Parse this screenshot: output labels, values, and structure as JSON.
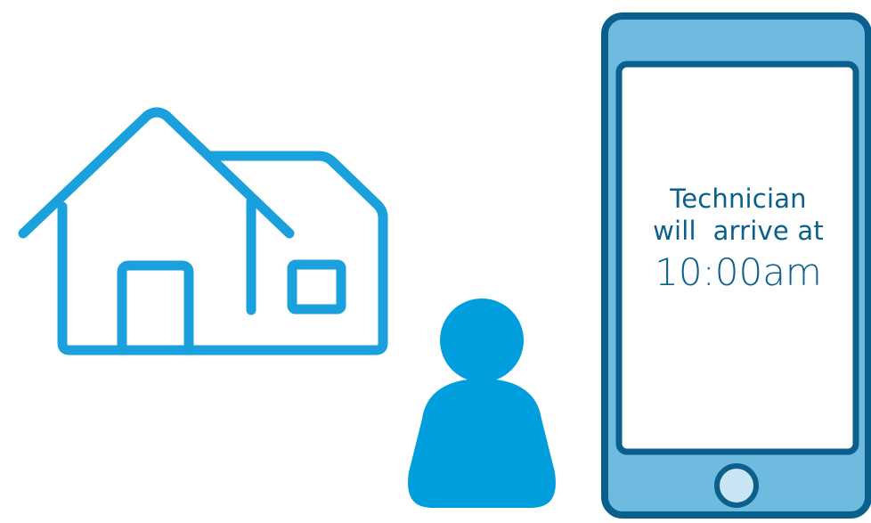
{
  "colors": {
    "house_stroke": "#1aa0dc",
    "person_fill": "#009edc",
    "phone_body": "#6fbbe0",
    "phone_outline": "#0b5f8c",
    "screen_fill": "#ffffff",
    "home_button": "#c9e4f2",
    "text": "#0a5f8c"
  },
  "icons": {
    "house": "house-icon",
    "person": "person-icon",
    "phone": "smartphone-icon"
  },
  "phone_screen": {
    "line1": "Technician",
    "line2": "will  arrive at",
    "time": "10:00am"
  }
}
